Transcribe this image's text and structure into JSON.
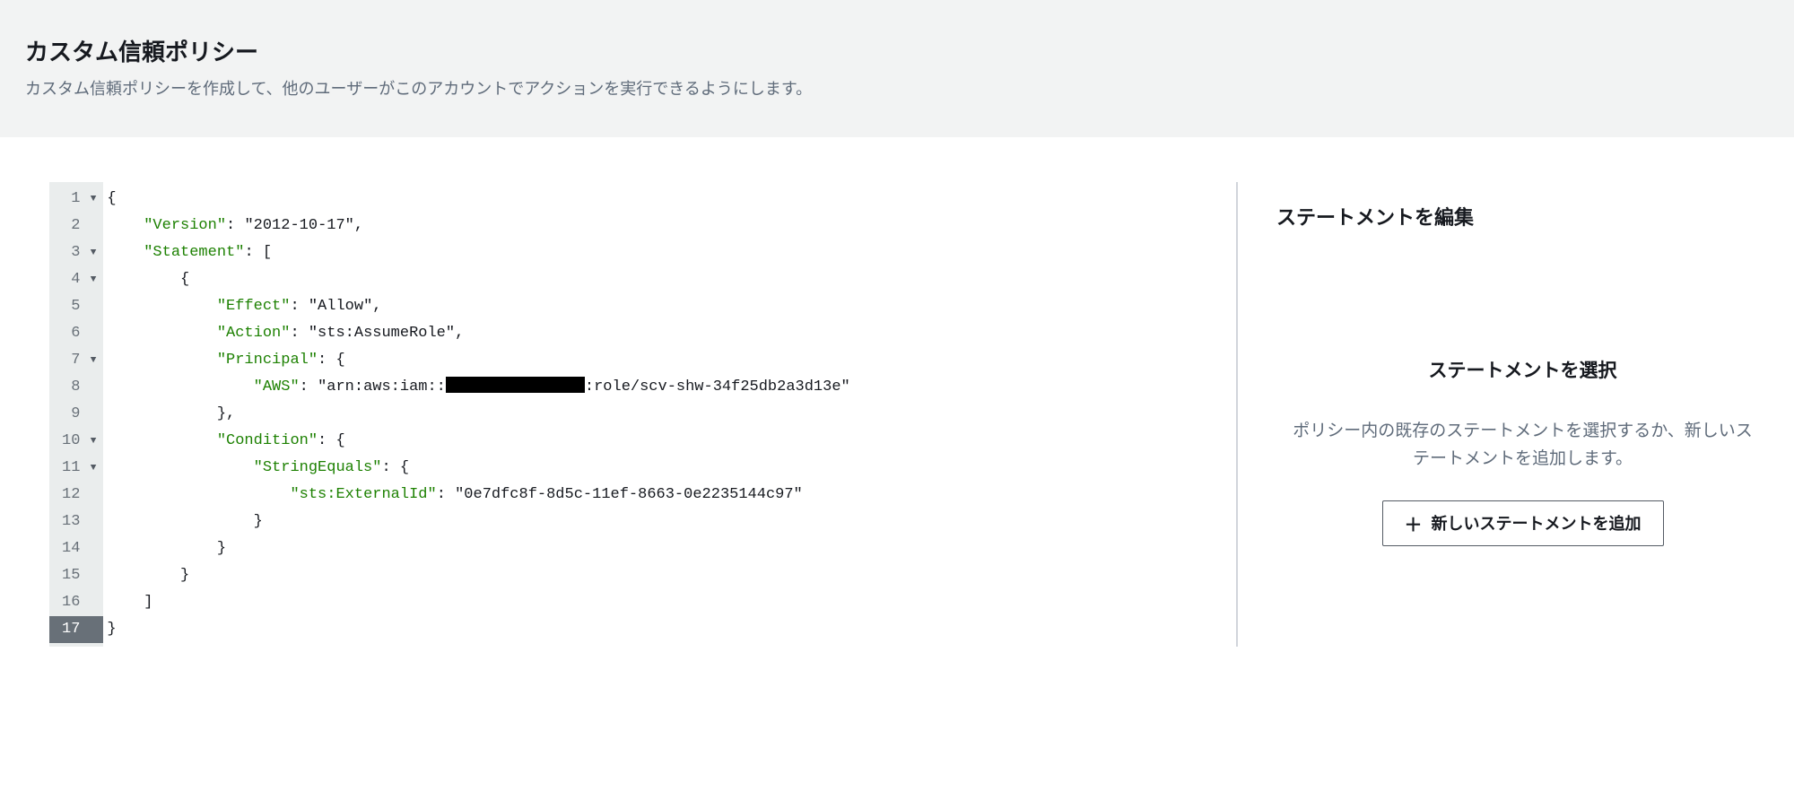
{
  "header": {
    "title": "カスタム信頼ポリシー",
    "description": "カスタム信頼ポリシーを作成して、他のユーザーがこのアカウントでアクションを実行できるようにします。"
  },
  "editor": {
    "lines": [
      {
        "num": "1",
        "fold": true,
        "tokens": [
          {
            "t": "p",
            "v": "{"
          }
        ]
      },
      {
        "num": "2",
        "fold": false,
        "tokens": [
          {
            "t": "p",
            "v": "    "
          },
          {
            "t": "k",
            "v": "\"Version\""
          },
          {
            "t": "p",
            "v": ": "
          },
          {
            "t": "s",
            "v": "\"2012-10-17\""
          },
          {
            "t": "p",
            "v": ","
          }
        ]
      },
      {
        "num": "3",
        "fold": true,
        "tokens": [
          {
            "t": "p",
            "v": "    "
          },
          {
            "t": "k",
            "v": "\"Statement\""
          },
          {
            "t": "p",
            "v": ": ["
          }
        ]
      },
      {
        "num": "4",
        "fold": true,
        "tokens": [
          {
            "t": "p",
            "v": "        {"
          }
        ]
      },
      {
        "num": "5",
        "fold": false,
        "tokens": [
          {
            "t": "p",
            "v": "            "
          },
          {
            "t": "k",
            "v": "\"Effect\""
          },
          {
            "t": "p",
            "v": ": "
          },
          {
            "t": "s",
            "v": "\"Allow\""
          },
          {
            "t": "p",
            "v": ","
          }
        ]
      },
      {
        "num": "6",
        "fold": false,
        "tokens": [
          {
            "t": "p",
            "v": "            "
          },
          {
            "t": "k",
            "v": "\"Action\""
          },
          {
            "t": "p",
            "v": ": "
          },
          {
            "t": "s",
            "v": "\"sts:AssumeRole\""
          },
          {
            "t": "p",
            "v": ","
          }
        ]
      },
      {
        "num": "7",
        "fold": true,
        "tokens": [
          {
            "t": "p",
            "v": "            "
          },
          {
            "t": "k",
            "v": "\"Principal\""
          },
          {
            "t": "p",
            "v": ": {"
          }
        ]
      },
      {
        "num": "8",
        "fold": false,
        "tokens": [
          {
            "t": "p",
            "v": "                "
          },
          {
            "t": "k",
            "v": "\"AWS\""
          },
          {
            "t": "p",
            "v": ": "
          },
          {
            "t": "s",
            "v": "\"arn:aws:iam::"
          },
          {
            "t": "redact",
            "v": ""
          },
          {
            "t": "s",
            "v": ":role/scv-shw-34f25db2a3d13e\""
          }
        ]
      },
      {
        "num": "9",
        "fold": false,
        "tokens": [
          {
            "t": "p",
            "v": "            },"
          }
        ]
      },
      {
        "num": "10",
        "fold": true,
        "tokens": [
          {
            "t": "p",
            "v": "            "
          },
          {
            "t": "k",
            "v": "\"Condition\""
          },
          {
            "t": "p",
            "v": ": {"
          }
        ]
      },
      {
        "num": "11",
        "fold": true,
        "tokens": [
          {
            "t": "p",
            "v": "                "
          },
          {
            "t": "k",
            "v": "\"StringEquals\""
          },
          {
            "t": "p",
            "v": ": {"
          }
        ]
      },
      {
        "num": "12",
        "fold": false,
        "tokens": [
          {
            "t": "p",
            "v": "                    "
          },
          {
            "t": "k",
            "v": "\"sts:ExternalId\""
          },
          {
            "t": "p",
            "v": ": "
          },
          {
            "t": "s",
            "v": "\"0e7dfc8f-8d5c-11ef-8663-0e2235144c97\""
          }
        ]
      },
      {
        "num": "13",
        "fold": false,
        "tokens": [
          {
            "t": "p",
            "v": "                }"
          }
        ]
      },
      {
        "num": "14",
        "fold": false,
        "tokens": [
          {
            "t": "p",
            "v": "            }"
          }
        ]
      },
      {
        "num": "15",
        "fold": false,
        "tokens": [
          {
            "t": "p",
            "v": "        }"
          }
        ]
      },
      {
        "num": "16",
        "fold": false,
        "tokens": [
          {
            "t": "p",
            "v": "    ]"
          }
        ]
      },
      {
        "num": "17",
        "fold": false,
        "active": true,
        "tokens": [
          {
            "t": "p",
            "v": "}"
          }
        ]
      }
    ]
  },
  "sidepanel": {
    "title": "ステートメントを編集",
    "subtitle": "ステートメントを選択",
    "text": "ポリシー内の既存のステートメントを選択するか、新しいステートメントを追加します。",
    "add_button_label": "新しいステートメントを追加"
  }
}
